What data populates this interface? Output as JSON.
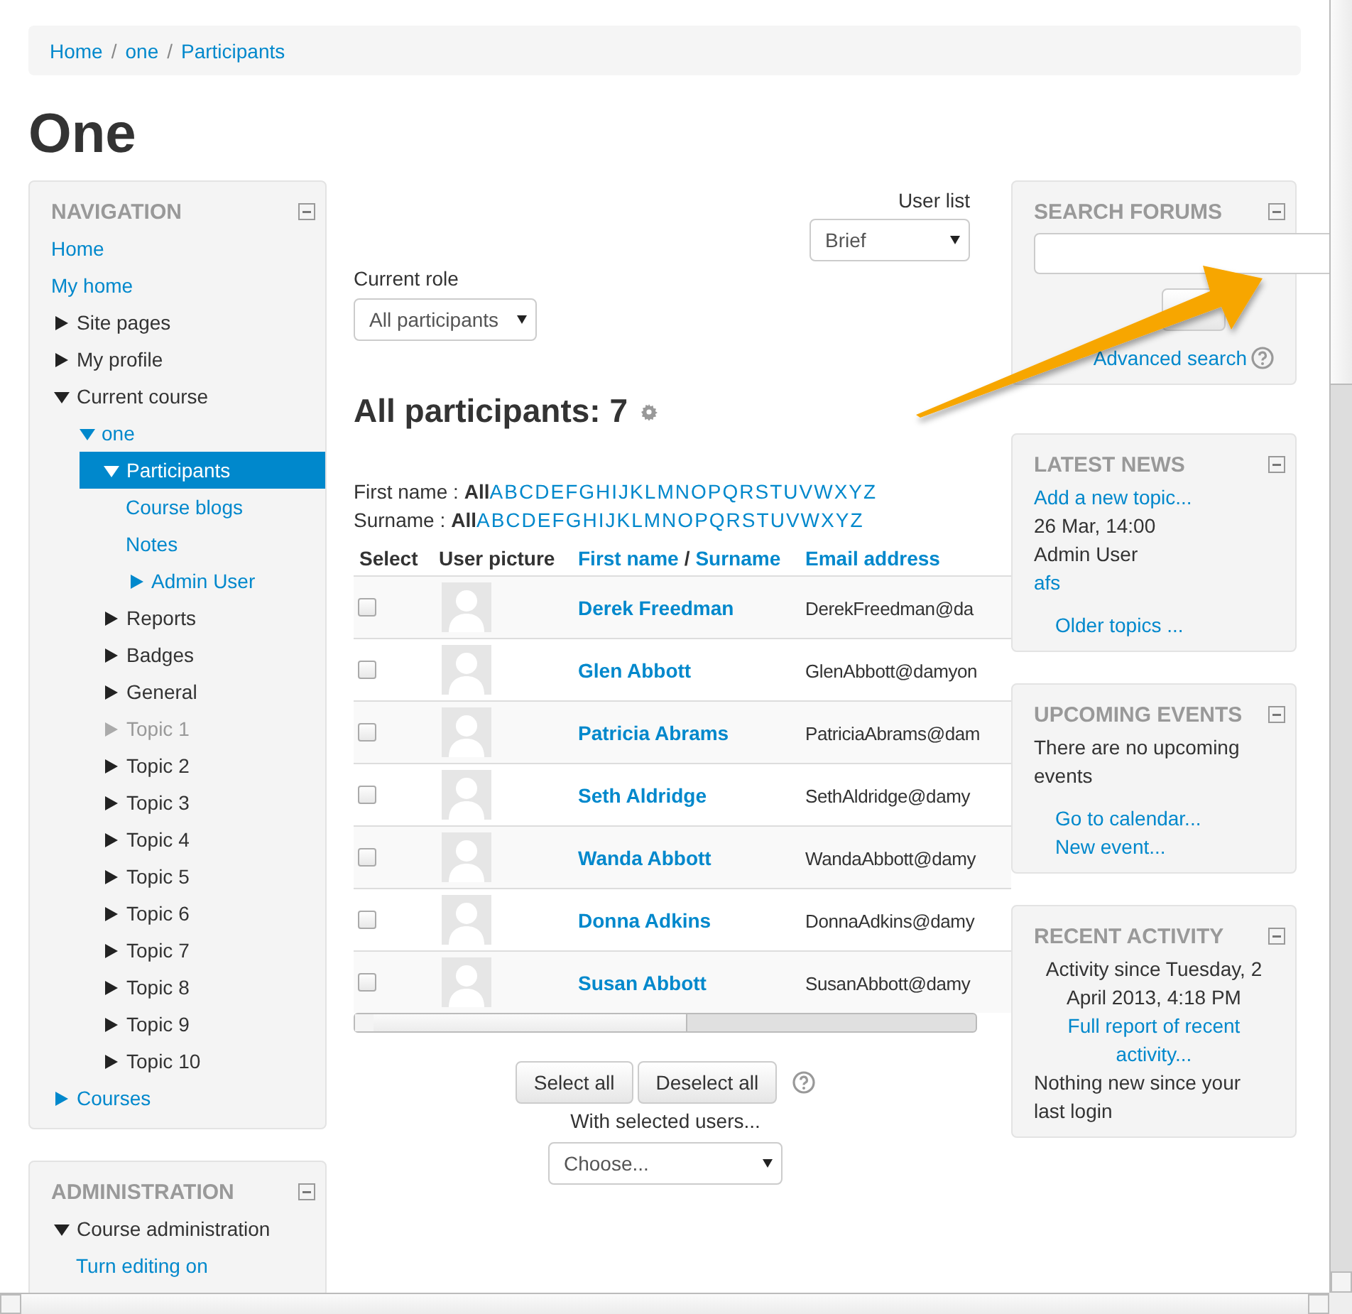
{
  "breadcrumb": {
    "separator": "/",
    "items": [
      {
        "label": "Home"
      },
      {
        "label": "one"
      },
      {
        "label": "Participants"
      }
    ]
  },
  "page_title": "One",
  "navigation": {
    "title": "NAVIGATION",
    "items": [
      {
        "label": "Home",
        "kind": "link",
        "selected": false,
        "dimmed": false
      },
      {
        "label": "My home",
        "kind": "link",
        "selected": false,
        "dimmed": false
      },
      {
        "label": "Site pages",
        "kind": "text",
        "expanded": false,
        "selected": false,
        "dimmed": false
      },
      {
        "label": "My profile",
        "kind": "text",
        "expanded": false,
        "selected": false,
        "dimmed": false
      },
      {
        "label": "Current course",
        "kind": "text",
        "expanded": true,
        "selected": false,
        "dimmed": false,
        "children": [
          {
            "label": "one",
            "kind": "link",
            "expanded": true,
            "selected": false,
            "dimmed": false,
            "children": [
              {
                "label": "Participants",
                "kind": "link",
                "expanded": true,
                "selected": true,
                "dimmed": false,
                "children": [
                  {
                    "label": "Course blogs",
                    "kind": "link",
                    "selected": false,
                    "dimmed": false
                  },
                  {
                    "label": "Notes",
                    "kind": "link",
                    "selected": false,
                    "dimmed": false
                  },
                  {
                    "label": "Admin User",
                    "kind": "link",
                    "expanded": false,
                    "selected": false,
                    "dimmed": false
                  }
                ]
              },
              {
                "label": "Reports",
                "kind": "text",
                "expanded": false,
                "selected": false,
                "dimmed": false
              },
              {
                "label": "Badges",
                "kind": "text",
                "expanded": false,
                "selected": false,
                "dimmed": false
              },
              {
                "label": "General",
                "kind": "text",
                "expanded": false,
                "selected": false,
                "dimmed": false
              },
              {
                "label": "Topic 1",
                "kind": "text",
                "expanded": false,
                "selected": false,
                "dimmed": true
              },
              {
                "label": "Topic 2",
                "kind": "text",
                "expanded": false,
                "selected": false,
                "dimmed": false
              },
              {
                "label": "Topic 3",
                "kind": "text",
                "expanded": false,
                "selected": false,
                "dimmed": false
              },
              {
                "label": "Topic 4",
                "kind": "text",
                "expanded": false,
                "selected": false,
                "dimmed": false
              },
              {
                "label": "Topic 5",
                "kind": "text",
                "expanded": false,
                "selected": false,
                "dimmed": false
              },
              {
                "label": "Topic 6",
                "kind": "text",
                "expanded": false,
                "selected": false,
                "dimmed": false
              },
              {
                "label": "Topic 7",
                "kind": "text",
                "expanded": false,
                "selected": false,
                "dimmed": false
              },
              {
                "label": "Topic 8",
                "kind": "text",
                "expanded": false,
                "selected": false,
                "dimmed": false
              },
              {
                "label": "Topic 9",
                "kind": "text",
                "expanded": false,
                "selected": false,
                "dimmed": false
              },
              {
                "label": "Topic 10",
                "kind": "text",
                "expanded": false,
                "selected": false,
                "dimmed": false
              }
            ]
          }
        ]
      },
      {
        "label": "Courses",
        "kind": "link",
        "expanded": false,
        "selected": false,
        "dimmed": false
      }
    ]
  },
  "administration": {
    "title": "ADMINISTRATION",
    "items": [
      {
        "label": "Course administration",
        "kind": "text",
        "expanded": true,
        "selected": false,
        "dimmed": false,
        "children": [
          {
            "label": "Turn editing on",
            "kind": "link",
            "selected": false,
            "dimmed": false
          }
        ]
      }
    ]
  },
  "user_list": {
    "label": "User list",
    "value": "Brief"
  },
  "current_role": {
    "label": "Current role",
    "value": "All participants"
  },
  "heading": "All participants: 7",
  "initial_bars": [
    {
      "label": "First name :",
      "letters": [
        {
          "text": "All",
          "selected": true
        },
        {
          "text": "A",
          "selected": false
        },
        {
          "text": "B",
          "selected": false
        },
        {
          "text": "C",
          "selected": false
        },
        {
          "text": "D",
          "selected": false
        },
        {
          "text": "E",
          "selected": false
        },
        {
          "text": "F",
          "selected": false
        },
        {
          "text": "G",
          "selected": false
        },
        {
          "text": "H",
          "selected": false
        },
        {
          "text": "I",
          "selected": false
        },
        {
          "text": "J",
          "selected": false
        },
        {
          "text": "K",
          "selected": false
        },
        {
          "text": "L",
          "selected": false
        },
        {
          "text": "M",
          "selected": false
        },
        {
          "text": "N",
          "selected": false
        },
        {
          "text": "O",
          "selected": false
        },
        {
          "text": "P",
          "selected": false
        },
        {
          "text": "Q",
          "selected": false
        },
        {
          "text": "R",
          "selected": false
        },
        {
          "text": "S",
          "selected": false
        },
        {
          "text": "T",
          "selected": false
        },
        {
          "text": "U",
          "selected": false
        },
        {
          "text": "V",
          "selected": false
        },
        {
          "text": "W",
          "selected": false
        },
        {
          "text": "X",
          "selected": false
        },
        {
          "text": "Y",
          "selected": false
        },
        {
          "text": "Z",
          "selected": false
        }
      ]
    },
    {
      "label": "Surname :",
      "letters": [
        {
          "text": "All",
          "selected": true
        },
        {
          "text": "A",
          "selected": false
        },
        {
          "text": "B",
          "selected": false
        },
        {
          "text": "C",
          "selected": false
        },
        {
          "text": "D",
          "selected": false
        },
        {
          "text": "E",
          "selected": false
        },
        {
          "text": "F",
          "selected": false
        },
        {
          "text": "G",
          "selected": false
        },
        {
          "text": "H",
          "selected": false
        },
        {
          "text": "I",
          "selected": false
        },
        {
          "text": "J",
          "selected": false
        },
        {
          "text": "K",
          "selected": false
        },
        {
          "text": "L",
          "selected": false
        },
        {
          "text": "M",
          "selected": false
        },
        {
          "text": "N",
          "selected": false
        },
        {
          "text": "O",
          "selected": false
        },
        {
          "text": "P",
          "selected": false
        },
        {
          "text": "Q",
          "selected": false
        },
        {
          "text": "R",
          "selected": false
        },
        {
          "text": "S",
          "selected": false
        },
        {
          "text": "T",
          "selected": false
        },
        {
          "text": "U",
          "selected": false
        },
        {
          "text": "V",
          "selected": false
        },
        {
          "text": "W",
          "selected": false
        },
        {
          "text": "X",
          "selected": false
        },
        {
          "text": "Y",
          "selected": false
        },
        {
          "text": "Z",
          "selected": false
        }
      ]
    }
  ],
  "table": {
    "columns": [
      {
        "kind": "text",
        "labels": [
          "Select"
        ]
      },
      {
        "kind": "text",
        "labels": [
          "User picture"
        ]
      },
      {
        "kind": "link",
        "labels": [
          "First name",
          "Surname"
        ],
        "separator": "/"
      },
      {
        "kind": "link",
        "labels": [
          "Email address"
        ]
      }
    ],
    "rows": [
      {
        "checked": false,
        "name": "Derek Freedman",
        "email": "DerekFreedman@da"
      },
      {
        "checked": false,
        "name": "Glen Abbott",
        "email": "GlenAbbott@damyon"
      },
      {
        "checked": false,
        "name": "Patricia Abrams",
        "email": "PatriciaAbrams@dam"
      },
      {
        "checked": false,
        "name": "Seth Aldridge",
        "email": "SethAldridge@damy"
      },
      {
        "checked": false,
        "name": "Wanda Abbott",
        "email": "WandaAbbott@damy"
      },
      {
        "checked": false,
        "name": "Donna Adkins",
        "email": "DonnaAdkins@damy"
      },
      {
        "checked": false,
        "name": "Susan Abbott",
        "email": "SusanAbbott@damy"
      }
    ]
  },
  "actions": {
    "buttons": [
      "Select all",
      "Deselect all"
    ],
    "label": "With selected users...",
    "select": "Choose..."
  },
  "blocks": [
    {
      "kind": "search",
      "title": "SEARCH FORUMS",
      "items": [
        {
          "kind": "help_link",
          "text": "Advanced search"
        }
      ]
    },
    {
      "kind": "list",
      "title": "LATEST NEWS",
      "items": [
        {
          "kind": "link",
          "text": "Add a new topic..."
        },
        {
          "kind": "text",
          "text": "26 Mar, 14:00"
        },
        {
          "kind": "text",
          "text": "Admin User"
        },
        {
          "kind": "link",
          "text": "afs"
        },
        {
          "kind": "footer_link",
          "text": "Older topics ..."
        }
      ]
    },
    {
      "kind": "list",
      "title": "UPCOMING EVENTS",
      "items": [
        {
          "kind": "text",
          "text": "There are no upcoming events"
        },
        {
          "kind": "footer_link",
          "text": "Go to calendar..."
        },
        {
          "kind": "footer_link",
          "text": "New event..."
        }
      ]
    },
    {
      "kind": "list",
      "title": "RECENT ACTIVITY",
      "items": [
        {
          "kind": "centered_text",
          "text": "Activity since Tuesday, 2 April 2013, 4:18 PM"
        },
        {
          "kind": "centered_link",
          "text": "Full report of recent activity..."
        },
        {
          "kind": "text",
          "text": "Nothing new since your last login"
        }
      ]
    }
  ]
}
